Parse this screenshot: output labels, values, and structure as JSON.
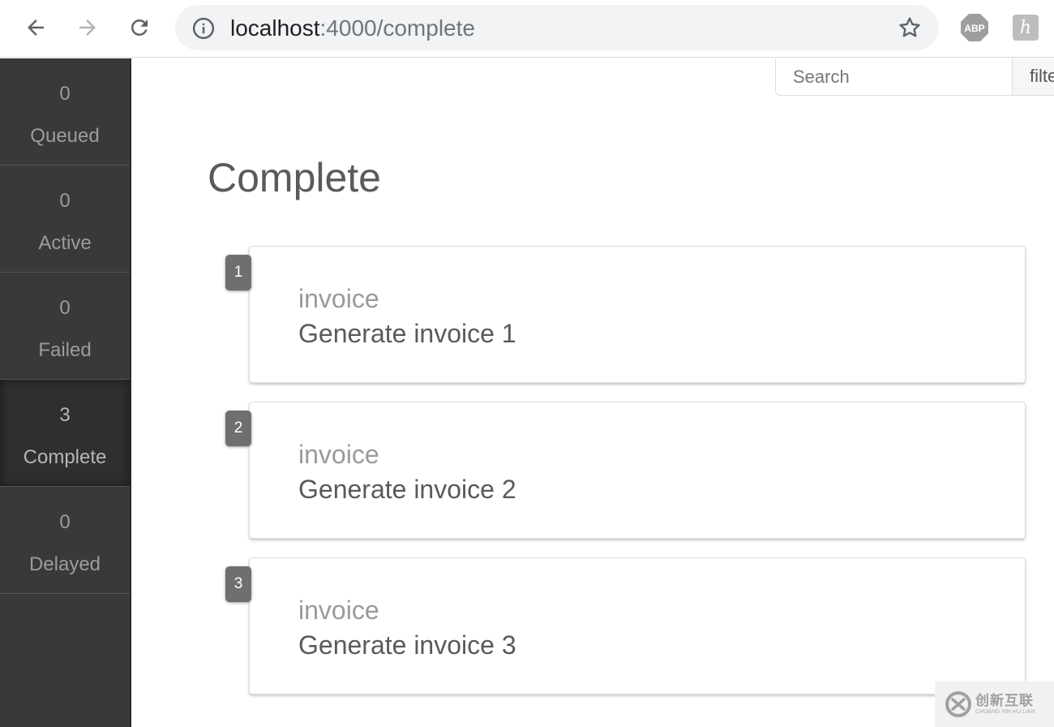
{
  "browser": {
    "url_host": "localhost",
    "url_path": ":4000/complete",
    "back_icon": "arrow-left-icon",
    "forward_icon": "arrow-right-icon",
    "reload_icon": "reload-icon",
    "info_icon": "info-circle-icon",
    "bookmark_icon": "star-icon",
    "extensions": [
      {
        "label": "ABP",
        "icon": "adblock-icon"
      },
      {
        "label": "h",
        "icon": "extension-h-icon"
      }
    ]
  },
  "sidebar": {
    "items": [
      {
        "count": "0",
        "label": "Queued"
      },
      {
        "count": "0",
        "label": "Active"
      },
      {
        "count": "0",
        "label": "Failed"
      },
      {
        "count": "3",
        "label": "Complete",
        "active": true
      },
      {
        "count": "0",
        "label": "Delayed"
      }
    ]
  },
  "search": {
    "placeholder": "Search",
    "filter_label": "filter"
  },
  "main": {
    "title": "Complete",
    "jobs": [
      {
        "id": "1",
        "type": "invoice",
        "title": "Generate invoice 1"
      },
      {
        "id": "2",
        "type": "invoice",
        "title": "Generate invoice 2"
      },
      {
        "id": "3",
        "type": "invoice",
        "title": "Generate invoice 3"
      }
    ]
  },
  "watermark": {
    "text_cn": "创新互联",
    "text_en": "CHUANG XIN HU LIAN"
  },
  "colors": {
    "sidebar_bg": "#393939",
    "sidebar_active_bg": "#2f2f2f",
    "badge_bg": "#6f6f6f",
    "omnibox_bg": "#f1f3f4"
  }
}
